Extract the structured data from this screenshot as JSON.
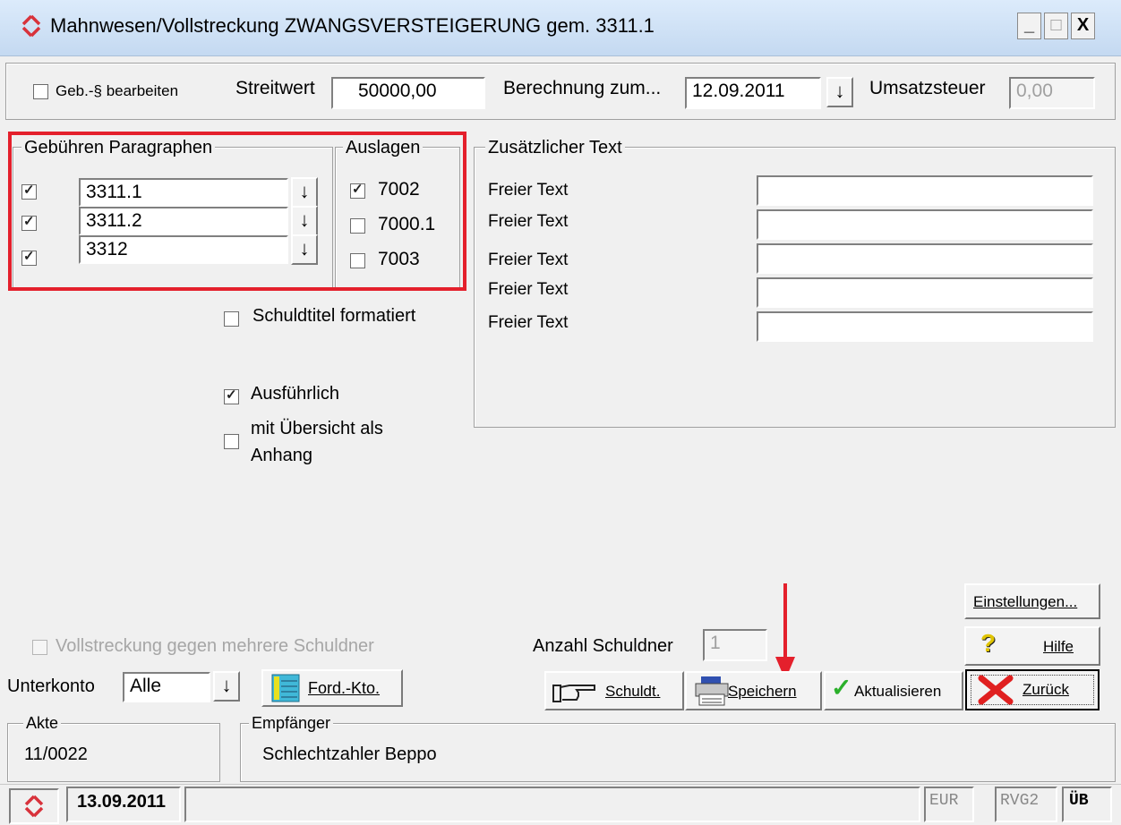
{
  "window": {
    "title": "Mahnwesen/Vollstreckung ZWANGSVERSTEIGERUNG gem. 3311.1",
    "controls": {
      "minimize": "_",
      "maximize": "□",
      "close": "X"
    }
  },
  "top": {
    "geb_label": "Geb.-§ bearbeiten",
    "geb_checked": false,
    "streitwert_label": "Streitwert",
    "streitwert_value": "50000,00",
    "berechnung_label": "Berechnung zum...",
    "berechnung_value": "12.09.2011",
    "umsatzsteuer_label": "Umsatzsteuer",
    "umsatzsteuer_value": "0,00"
  },
  "gebuehren": {
    "title": "Gebühren Paragraphen",
    "rows": [
      {
        "checked": true,
        "value": "3311.1"
      },
      {
        "checked": true,
        "value": "3311.2"
      },
      {
        "checked": true,
        "value": "3312"
      }
    ]
  },
  "auslagen": {
    "title": "Auslagen",
    "items": [
      {
        "checked": true,
        "label": "7002"
      },
      {
        "checked": false,
        "label": "7000.1"
      },
      {
        "checked": false,
        "label": "7003"
      }
    ]
  },
  "zusatz": {
    "title": "Zusätzlicher Text",
    "rows": [
      {
        "label": "Freier Text",
        "value": ""
      },
      {
        "label": "Freier Text",
        "value": ""
      },
      {
        "label": "Freier Text",
        "value": ""
      },
      {
        "label": "Freier Text",
        "value": ""
      },
      {
        "label": "Freier Text",
        "value": ""
      }
    ]
  },
  "options": {
    "schuldtitel": "Schuldtitel formatiert",
    "ausfuehrlich": "Ausführlich",
    "uebersicht_line1": "mit Übersicht als",
    "uebersicht_line2": "Anhang"
  },
  "bottom": {
    "vollstreckung": "Vollstreckung gegen mehrere Schuldner",
    "unterkonto_label": "Unterkonto",
    "unterkonto_value": "Alle",
    "ford_kto": "Ford.-Kto.",
    "anzahl_label": "Anzahl Schuldner",
    "anzahl_value": "1",
    "einstellungen": "Einstellungen...",
    "hilfe": "Hilfe",
    "schuldt": "Schuldt.",
    "speichern": "Speichern",
    "aktualisieren": "Aktualisieren",
    "zurueck": "Zurück"
  },
  "info": {
    "akte_label": "Akte",
    "akte_value": "11/0022",
    "empfaenger_label": "Empfänger",
    "empfaenger_value": "Schlechtzahler Beppo"
  },
  "status": {
    "date": "13.09.2011",
    "currency": "EUR",
    "rvg": "RVG2",
    "ub": "ÜB"
  },
  "colors": {
    "highlight_red": "#e4202c",
    "arrow_red": "#e4202c",
    "check_green": "#2bb02b"
  },
  "icons": [
    "app-logo-icon",
    "hand-pointer-icon",
    "printer-icon",
    "check-icon",
    "red-x-icon",
    "help-icon",
    "ledger-icon"
  ]
}
